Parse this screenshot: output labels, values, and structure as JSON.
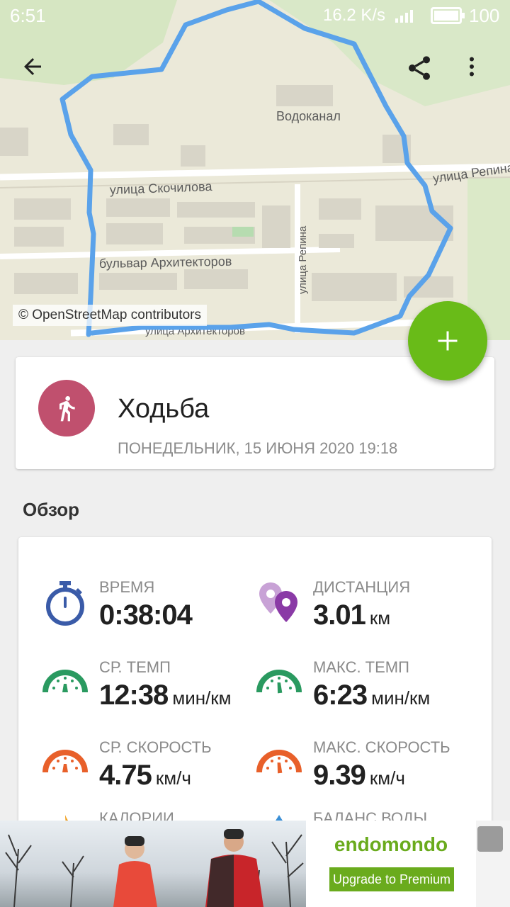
{
  "status_bar": {
    "time": "6:51",
    "speed": "16.2 K/s",
    "battery": "100"
  },
  "map": {
    "attribution": "© OpenStreetMap contributors",
    "labels": [
      "Водоканал",
      "улица Скочилова",
      "бульвар Архитекторов",
      "улица Репина",
      "улица Репина",
      "улица Архитекторов"
    ],
    "route_color": "#5aa2ea"
  },
  "toolbar": {
    "back_icon": "arrow-back-icon",
    "share_icon": "share-icon",
    "more_icon": "more-vert-icon"
  },
  "fab": {
    "icon": "plus-icon",
    "color": "#69bb18"
  },
  "activity": {
    "title": "Ходьба",
    "date": "ПОНЕДЕЛЬНИК, 15 ИЮНЯ 2020 19:18",
    "icon": "walking-icon",
    "color": "#c0506e"
  },
  "overview": {
    "heading": "Обзор",
    "stats": [
      {
        "label": "ВРЕМЯ",
        "value": "0:38:04",
        "unit": "",
        "icon": "stopwatch-icon"
      },
      {
        "label": "ДИСТАНЦИЯ",
        "value": "3.01",
        "unit": "км",
        "icon": "map-pins-icon"
      },
      {
        "label": "СР. ТЕМП",
        "value": "12:38",
        "unit": "мин/км",
        "icon": "pace-gauge-icon"
      },
      {
        "label": "МАКС. ТЕМП",
        "value": "6:23",
        "unit": "мин/км",
        "icon": "pace-gauge-icon"
      },
      {
        "label": "СР. СКОРОСТЬ",
        "value": "4.75",
        "unit": "км/ч",
        "icon": "speed-gauge-icon"
      },
      {
        "label": "МАКС. СКОРОСТЬ",
        "value": "9.39",
        "unit": "км/ч",
        "icon": "speed-gauge-icon"
      },
      {
        "label": "КАЛОРИИ",
        "value": "",
        "unit": "",
        "icon": "flame-icon"
      },
      {
        "label": "БАЛАНС ВОДЫ",
        "value": "",
        "unit": "",
        "icon": "water-icon"
      }
    ]
  },
  "ad": {
    "brand": "endomondo",
    "cta": "Upgrade to Premium"
  }
}
